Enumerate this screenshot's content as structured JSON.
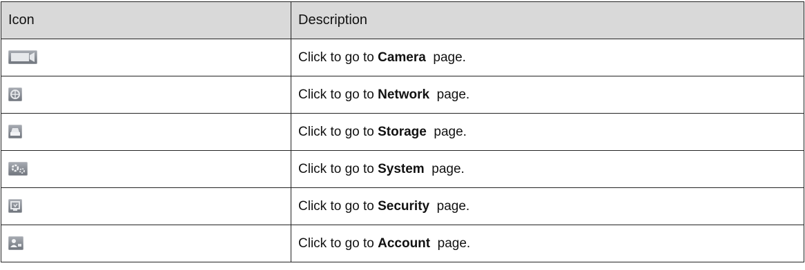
{
  "table": {
    "headers": {
      "icon": "Icon",
      "description": "Description"
    },
    "rows": [
      {
        "icon": "camera-icon",
        "prefix": "Click to go to ",
        "target": "Camera",
        "suffix": "  page."
      },
      {
        "icon": "network-icon",
        "prefix": "Click to go to ",
        "target": "Network",
        "suffix": "  page."
      },
      {
        "icon": "storage-icon",
        "prefix": "Click to go to ",
        "target": "Storage",
        "suffix": "  page."
      },
      {
        "icon": "system-icon",
        "prefix": "Click to go to ",
        "target": "System",
        "suffix": "  page."
      },
      {
        "icon": "security-icon",
        "prefix": "Click to go to ",
        "target": "Security",
        "suffix": "  page."
      },
      {
        "icon": "account-icon",
        "prefix": "Click to go to ",
        "target": "Account",
        "suffix": "  page."
      }
    ]
  }
}
